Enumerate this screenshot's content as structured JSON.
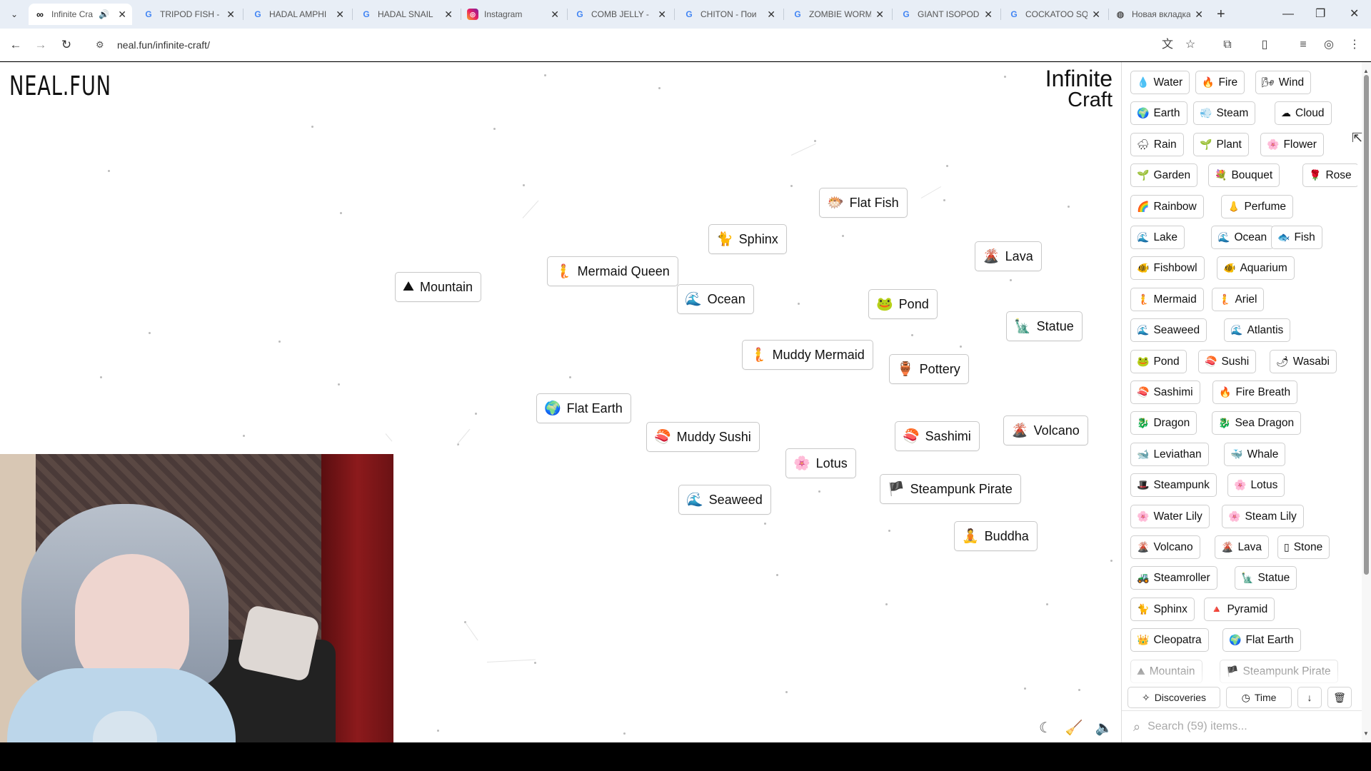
{
  "browser": {
    "tabs": [
      {
        "title": "Infinite Cra",
        "icon": "infinity-icon",
        "active": true,
        "speaker": true
      },
      {
        "title": "TRIPOD FISH -",
        "icon": "google-icon"
      },
      {
        "title": "HADAL AMPHI",
        "icon": "google-icon"
      },
      {
        "title": "HADAL SNAIL",
        "icon": "google-icon"
      },
      {
        "title": "Instagram",
        "icon": "instagram-icon"
      },
      {
        "title": "COMB JELLY - ",
        "icon": "google-icon"
      },
      {
        "title": "CHITON - Пои",
        "icon": "google-icon"
      },
      {
        "title": "ZOMBIE WORM",
        "icon": "google-icon"
      },
      {
        "title": "GIANT ISOPOD",
        "icon": "google-icon"
      },
      {
        "title": "COCKATOO SQ",
        "icon": "google-icon"
      },
      {
        "title": "Новая вкладка",
        "icon": "globe-icon"
      }
    ],
    "url": "neal.fun/infinite-craft/"
  },
  "page": {
    "logo_left": "NEAL.FUN",
    "logo_right_line1": "Infinite",
    "logo_right_line2": "Craft"
  },
  "canvas_elements": [
    {
      "label": "Flat Fish",
      "emoji": "🐡"
    },
    {
      "label": "Sphinx",
      "emoji": "🐈"
    },
    {
      "label": "Lava",
      "emoji": "🌋"
    },
    {
      "label": "Mermaid Queen",
      "emoji": "🧜"
    },
    {
      "label": "Mountain",
      "emoji": "⛰"
    },
    {
      "label": "Ocean",
      "emoji": "🌊"
    },
    {
      "label": "Pond",
      "emoji": "🐸"
    },
    {
      "label": "Statue",
      "emoji": "🗽"
    },
    {
      "label": "Muddy Mermaid",
      "emoji": "🧜"
    },
    {
      "label": "Pottery",
      "emoji": "🏺"
    },
    {
      "label": "Flat Earth",
      "emoji": "🌍"
    },
    {
      "label": "Muddy Sushi",
      "emoji": "🍣"
    },
    {
      "label": "Sashimi",
      "emoji": "🍣"
    },
    {
      "label": "Volcano",
      "emoji": "🌋"
    },
    {
      "label": "Lotus",
      "emoji": "🌸"
    },
    {
      "label": "Steampunk Pirate",
      "emoji": "🏴"
    },
    {
      "label": "Seaweed",
      "emoji": "🌊"
    },
    {
      "label": "Buddha",
      "emoji": "🧘"
    }
  ],
  "sidebar": {
    "items": [
      {
        "label": "Water",
        "emoji": "💧"
      },
      {
        "label": "Fire",
        "emoji": "🔥"
      },
      {
        "label": "Wind",
        "emoji": "🌬"
      },
      {
        "label": "Earth",
        "emoji": "🌍"
      },
      {
        "label": "Steam",
        "emoji": "💨"
      },
      {
        "label": "Cloud",
        "emoji": "☁"
      },
      {
        "label": "Rain",
        "emoji": "🌧"
      },
      {
        "label": "Plant",
        "emoji": "🌱"
      },
      {
        "label": "Flower",
        "emoji": "🌸"
      },
      {
        "label": "Garden",
        "emoji": "🌱"
      },
      {
        "label": "Bouquet",
        "emoji": "💐"
      },
      {
        "label": "Rose",
        "emoji": "🌹"
      },
      {
        "label": "Rainbow",
        "emoji": "🌈"
      },
      {
        "label": "Perfume",
        "emoji": "👃"
      },
      {
        "label": "Lake",
        "emoji": "🌊"
      },
      {
        "label": "Ocean",
        "emoji": "🌊"
      },
      {
        "label": "Fish",
        "emoji": "🐟"
      },
      {
        "label": "Fishbowl",
        "emoji": "🐠"
      },
      {
        "label": "Aquarium",
        "emoji": "🐠"
      },
      {
        "label": "Mermaid",
        "emoji": "🧜"
      },
      {
        "label": "Ariel",
        "emoji": "🧜"
      },
      {
        "label": "Seaweed",
        "emoji": "🌊"
      },
      {
        "label": "Atlantis",
        "emoji": "🌊"
      },
      {
        "label": "Pond",
        "emoji": "🐸"
      },
      {
        "label": "Sushi",
        "emoji": "🍣"
      },
      {
        "label": "Wasabi",
        "emoji": "🌶"
      },
      {
        "label": "Sashimi",
        "emoji": "🍣"
      },
      {
        "label": "Fire Breath",
        "emoji": "🔥"
      },
      {
        "label": "Dragon",
        "emoji": "🐉"
      },
      {
        "label": "Sea Dragon",
        "emoji": "🐉"
      },
      {
        "label": "Leviathan",
        "emoji": "🐋"
      },
      {
        "label": "Whale",
        "emoji": "🐳"
      },
      {
        "label": "Steampunk",
        "emoji": "🎩"
      },
      {
        "label": "Lotus",
        "emoji": "🌸"
      },
      {
        "label": "Water Lily",
        "emoji": "🌸"
      },
      {
        "label": "Steam Lily",
        "emoji": "🌸"
      },
      {
        "label": "Volcano",
        "emoji": "🌋"
      },
      {
        "label": "Lava",
        "emoji": "🌋"
      },
      {
        "label": "Stone",
        "emoji": "▯"
      },
      {
        "label": "Steamroller",
        "emoji": "🚜"
      },
      {
        "label": "Statue",
        "emoji": "🗽"
      },
      {
        "label": "Sphinx",
        "emoji": "🐈"
      },
      {
        "label": "Pyramid",
        "emoji": "🔺"
      },
      {
        "label": "Cleopatra",
        "emoji": "👑"
      },
      {
        "label": "Flat Earth",
        "emoji": "🌍"
      },
      {
        "label": "Mountain",
        "emoji": "⛰",
        "faded": true
      },
      {
        "label": "Steampunk Pirate",
        "emoji": "🏴",
        "faded": true
      }
    ],
    "discoveries_label": "Discoveries",
    "time_label": "Time",
    "sort_arrow": "↓",
    "delete_icon": "🗑",
    "search_placeholder": "Search (59) items..."
  }
}
